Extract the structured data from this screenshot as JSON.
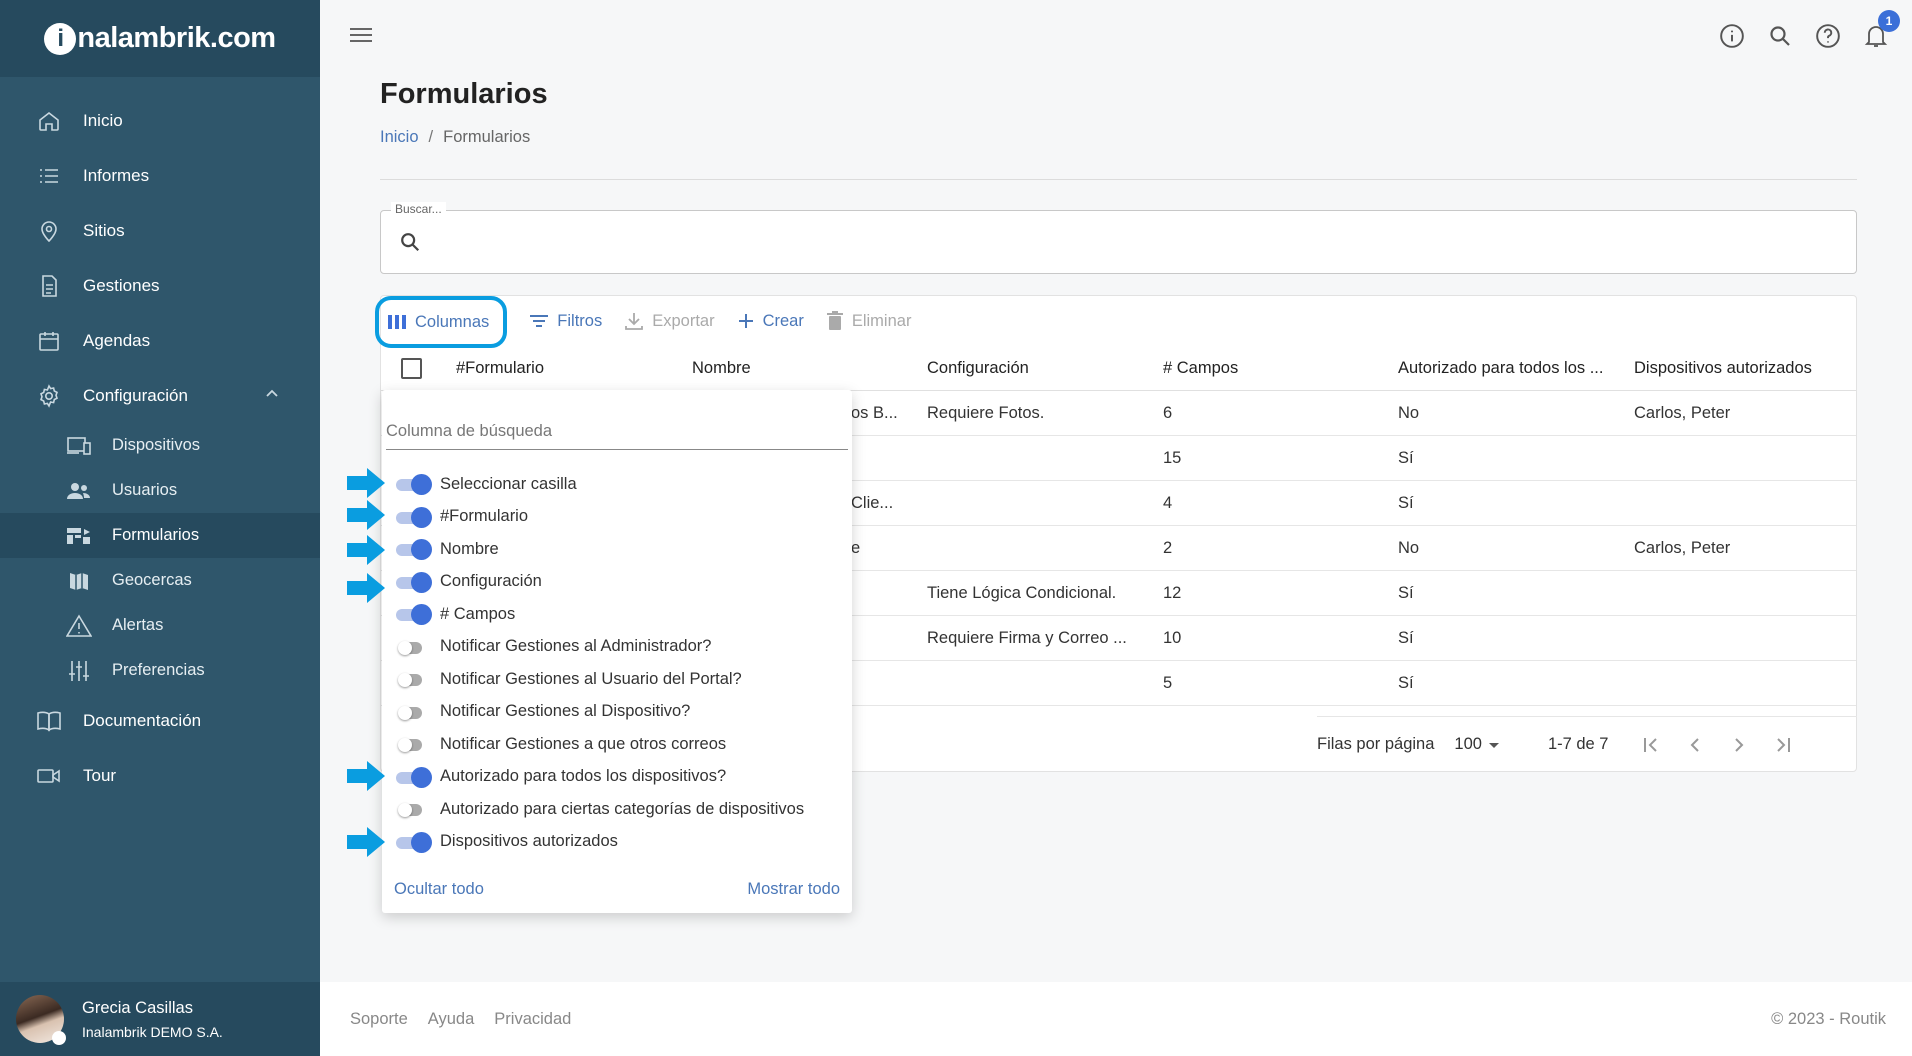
{
  "brand": {
    "logo_prefix": "i",
    "logo_rest": "nalambrik.com"
  },
  "sidebar": {
    "items": [
      {
        "label": "Inicio",
        "icon": "home-icon"
      },
      {
        "label": "Informes",
        "icon": "list-icon"
      },
      {
        "label": "Sitios",
        "icon": "location-pin-icon"
      },
      {
        "label": "Gestiones",
        "icon": "document-icon"
      },
      {
        "label": "Agendas",
        "icon": "calendar-icon"
      },
      {
        "label": "Configuración",
        "icon": "gear-icon"
      }
    ],
    "sub_items": [
      {
        "label": "Dispositivos",
        "icon": "devices-icon"
      },
      {
        "label": "Usuarios",
        "icon": "people-icon"
      },
      {
        "label": "Formularios",
        "icon": "form-icon"
      },
      {
        "label": "Geocercas",
        "icon": "map-icon"
      },
      {
        "label": "Alertas",
        "icon": "warning-icon"
      },
      {
        "label": "Preferencias",
        "icon": "sliders-icon"
      }
    ],
    "bottom_items": [
      {
        "label": "Documentación",
        "icon": "book-icon"
      },
      {
        "label": "Tour",
        "icon": "video-icon"
      }
    ],
    "user": {
      "name": "Grecia Casillas",
      "org": "Inalambrik DEMO S.A."
    }
  },
  "topbar": {
    "notification_count": "1"
  },
  "page": {
    "title": "Formularios",
    "breadcrumb_home": "Inicio",
    "breadcrumb_sep": "/",
    "breadcrumb_current": "Formularios"
  },
  "search": {
    "legend": "Buscar..."
  },
  "toolbar": {
    "columns": "Columnas",
    "filters": "Filtros",
    "export": "Exportar",
    "create": "Crear",
    "delete": "Eliminar"
  },
  "table": {
    "headers": [
      "#Formulario",
      "Nombre",
      "Configuración",
      "# Campos",
      "Autorizado para todos los ...",
      "Dispositivos autorizados"
    ],
    "rows": [
      {
        "nombre": "os B...",
        "config": "Requiere Fotos.",
        "campos": "6",
        "autorizado": "No",
        "dispositivos": "Carlos, Peter"
      },
      {
        "nombre": "",
        "config": "",
        "campos": "15",
        "autorizado": "Sí",
        "dispositivos": ""
      },
      {
        "nombre": "Clie...",
        "config": "",
        "campos": "4",
        "autorizado": "Sí",
        "dispositivos": ""
      },
      {
        "nombre": "e",
        "config": "",
        "campos": "2",
        "autorizado": "No",
        "dispositivos": "Carlos, Peter"
      },
      {
        "nombre": "",
        "config": "Tiene Lógica Condicional.",
        "campos": "12",
        "autorizado": "Sí",
        "dispositivos": ""
      },
      {
        "nombre": "",
        "config": "Requiere Firma y Correo ...",
        "campos": "10",
        "autorizado": "Sí",
        "dispositivos": ""
      },
      {
        "nombre": "",
        "config": "",
        "campos": "5",
        "autorizado": "Sí",
        "dispositivos": ""
      }
    ]
  },
  "pagination": {
    "rows_per_page_label": "Filas por página",
    "rows_per_page": "100",
    "range": "1-7 de 7"
  },
  "column_menu": {
    "search_placeholder": "Columna de búsqueda",
    "items": [
      {
        "label": "Seleccionar casilla",
        "on": true
      },
      {
        "label": "#Formulario",
        "on": true
      },
      {
        "label": "Nombre",
        "on": true
      },
      {
        "label": "Configuración",
        "on": true
      },
      {
        "label": "# Campos",
        "on": true
      },
      {
        "label": "Notificar Gestiones al Administrador?",
        "on": false
      },
      {
        "label": "Notificar Gestiones al Usuario del Portal?",
        "on": false
      },
      {
        "label": "Notificar Gestiones al Dispositivo?",
        "on": false
      },
      {
        "label": "Notificar Gestiones a que otros correos",
        "on": false
      },
      {
        "label": "Autorizado para todos los dispositivos?",
        "on": true
      },
      {
        "label": "Autorizado para ciertas categorías de dispositivos",
        "on": false
      },
      {
        "label": "Dispositivos autorizados",
        "on": true
      }
    ],
    "hide_all": "Ocultar todo",
    "show_all": "Mostrar todo"
  },
  "footer": {
    "support": "Soporte",
    "help": "Ayuda",
    "privacy": "Privacidad",
    "copyright": "© 2023 - Routik"
  },
  "colors": {
    "sidebar_bg": "#2f566b",
    "sidebar_dark": "#264a5e",
    "accent": "#4a77b8",
    "toggle_on": "#3e6fd8",
    "highlight_arrow": "#0a9de0"
  }
}
